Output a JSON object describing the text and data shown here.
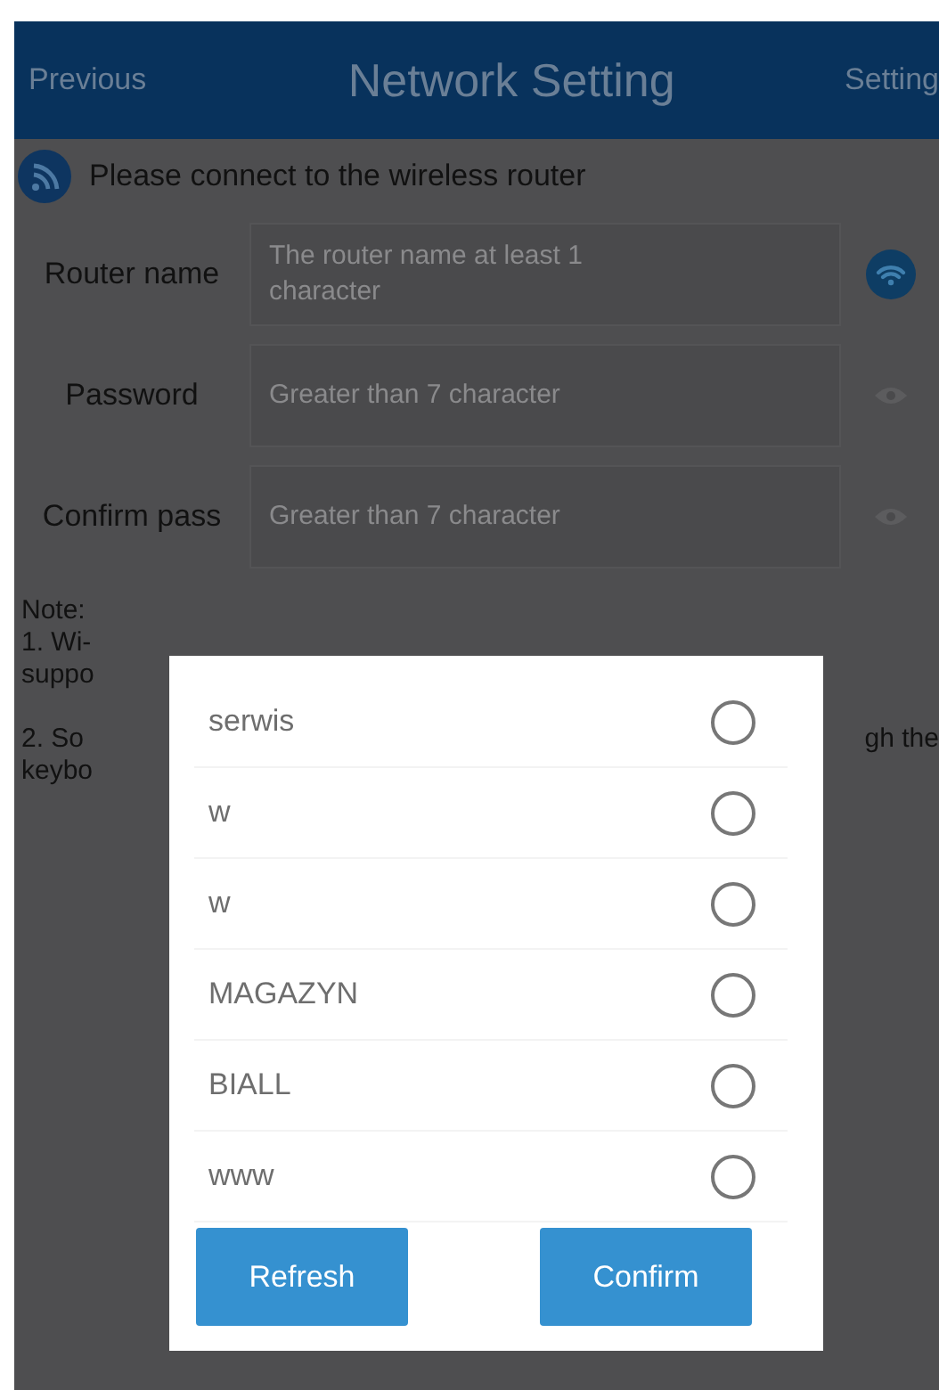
{
  "header": {
    "back": "Previous",
    "title": "Network Setting",
    "action": "Setting"
  },
  "info": "Please connect to the wireless router",
  "form": [
    {
      "label": "Router name",
      "placeholder": "The router name at least 1 character",
      "kind": "wifi"
    },
    {
      "label": "Password",
      "placeholder": "Greater than 7 character",
      "kind": "eye"
    },
    {
      "label": "Confirm pass",
      "placeholder": "Greater than 7 character",
      "kind": "eye"
    }
  ],
  "note_lines": [
    {
      "left": "Note:"
    },
    {
      "left": "1. Wi-"
    },
    {
      "left": "suppo"
    },
    {
      "left": "2. So",
      "right": "gh the"
    },
    {
      "left": "keybo"
    }
  ],
  "dialog": {
    "networks": [
      {
        "name": "serwis",
        "selected": false
      },
      {
        "name": "w",
        "selected": false
      },
      {
        "name": "w",
        "selected": false
      },
      {
        "name": "MAGAZYN",
        "selected": false
      },
      {
        "name": "BIALL",
        "selected": false
      },
      {
        "name": "www",
        "selected": false
      }
    ],
    "buttons": [
      "Refresh",
      "Confirm"
    ]
  }
}
